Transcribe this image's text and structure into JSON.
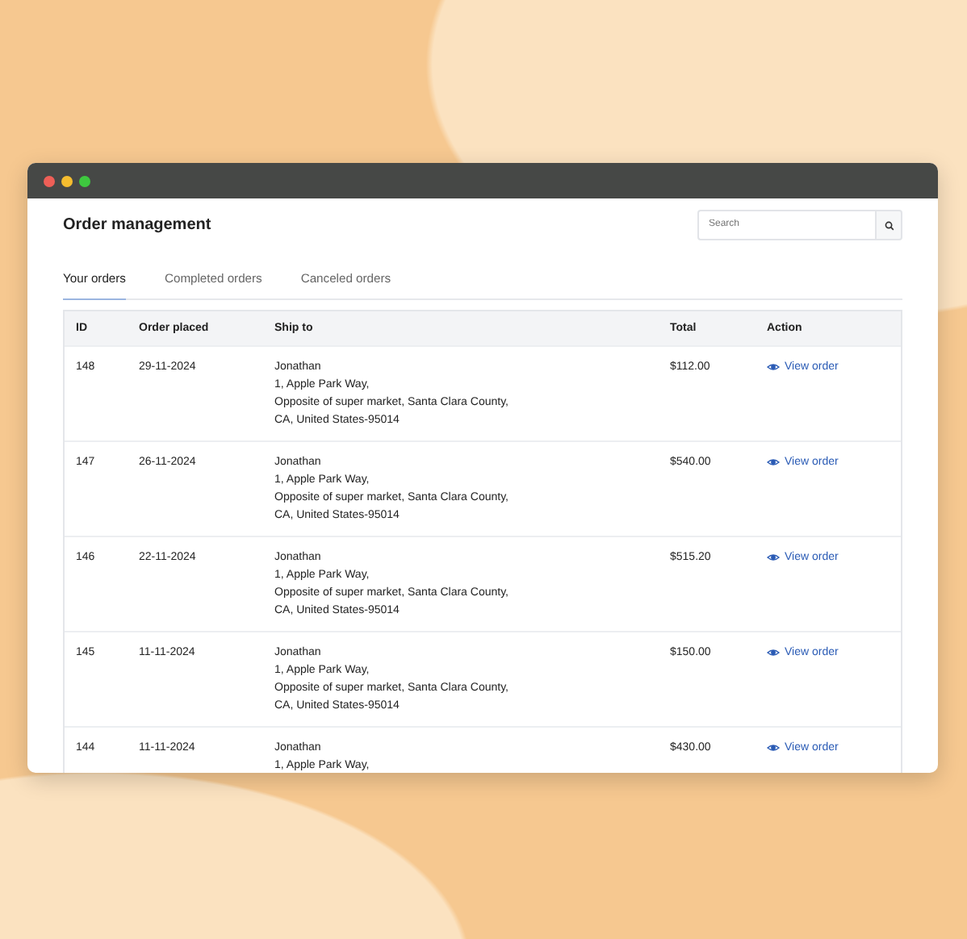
{
  "title": "Order management",
  "search": {
    "placeholder": "Search"
  },
  "tabs": [
    {
      "label": "Your orders",
      "selected": true
    },
    {
      "label": "Completed orders",
      "selected": false
    },
    {
      "label": "Canceled orders",
      "selected": false
    }
  ],
  "table": {
    "columns": [
      "ID",
      "Order placed",
      "Ship to",
      "Total",
      "Action"
    ],
    "rows": [
      {
        "id": "148",
        "placed": "29-11-2024",
        "ship_to": [
          "Jonathan",
          "1, Apple Park Way,",
          "Opposite of super market, Santa Clara County,",
          "CA, United States-95014"
        ],
        "total": "$112.00",
        "action": "View order"
      },
      {
        "id": "147",
        "placed": "26-11-2024",
        "ship_to": [
          "Jonathan",
          "1, Apple Park Way,",
          "Opposite of super market, Santa Clara County,",
          "CA, United States-95014"
        ],
        "total": "$540.00",
        "action": "View order"
      },
      {
        "id": "146",
        "placed": "22-11-2024",
        "ship_to": [
          "Jonathan",
          "1, Apple Park Way,",
          "Opposite of super market, Santa Clara County,",
          "CA, United States-95014"
        ],
        "total": "$515.20",
        "action": "View order"
      },
      {
        "id": "145",
        "placed": "11-11-2024",
        "ship_to": [
          "Jonathan",
          "1, Apple Park Way,",
          "Opposite of super market, Santa Clara County,",
          "CA, United States-95014"
        ],
        "total": "$150.00",
        "action": "View order"
      },
      {
        "id": "144",
        "placed": "11-11-2024",
        "ship_to": [
          "Jonathan",
          "1, Apple Park Way,"
        ],
        "total": "$430.00",
        "action": "View order"
      }
    ]
  }
}
